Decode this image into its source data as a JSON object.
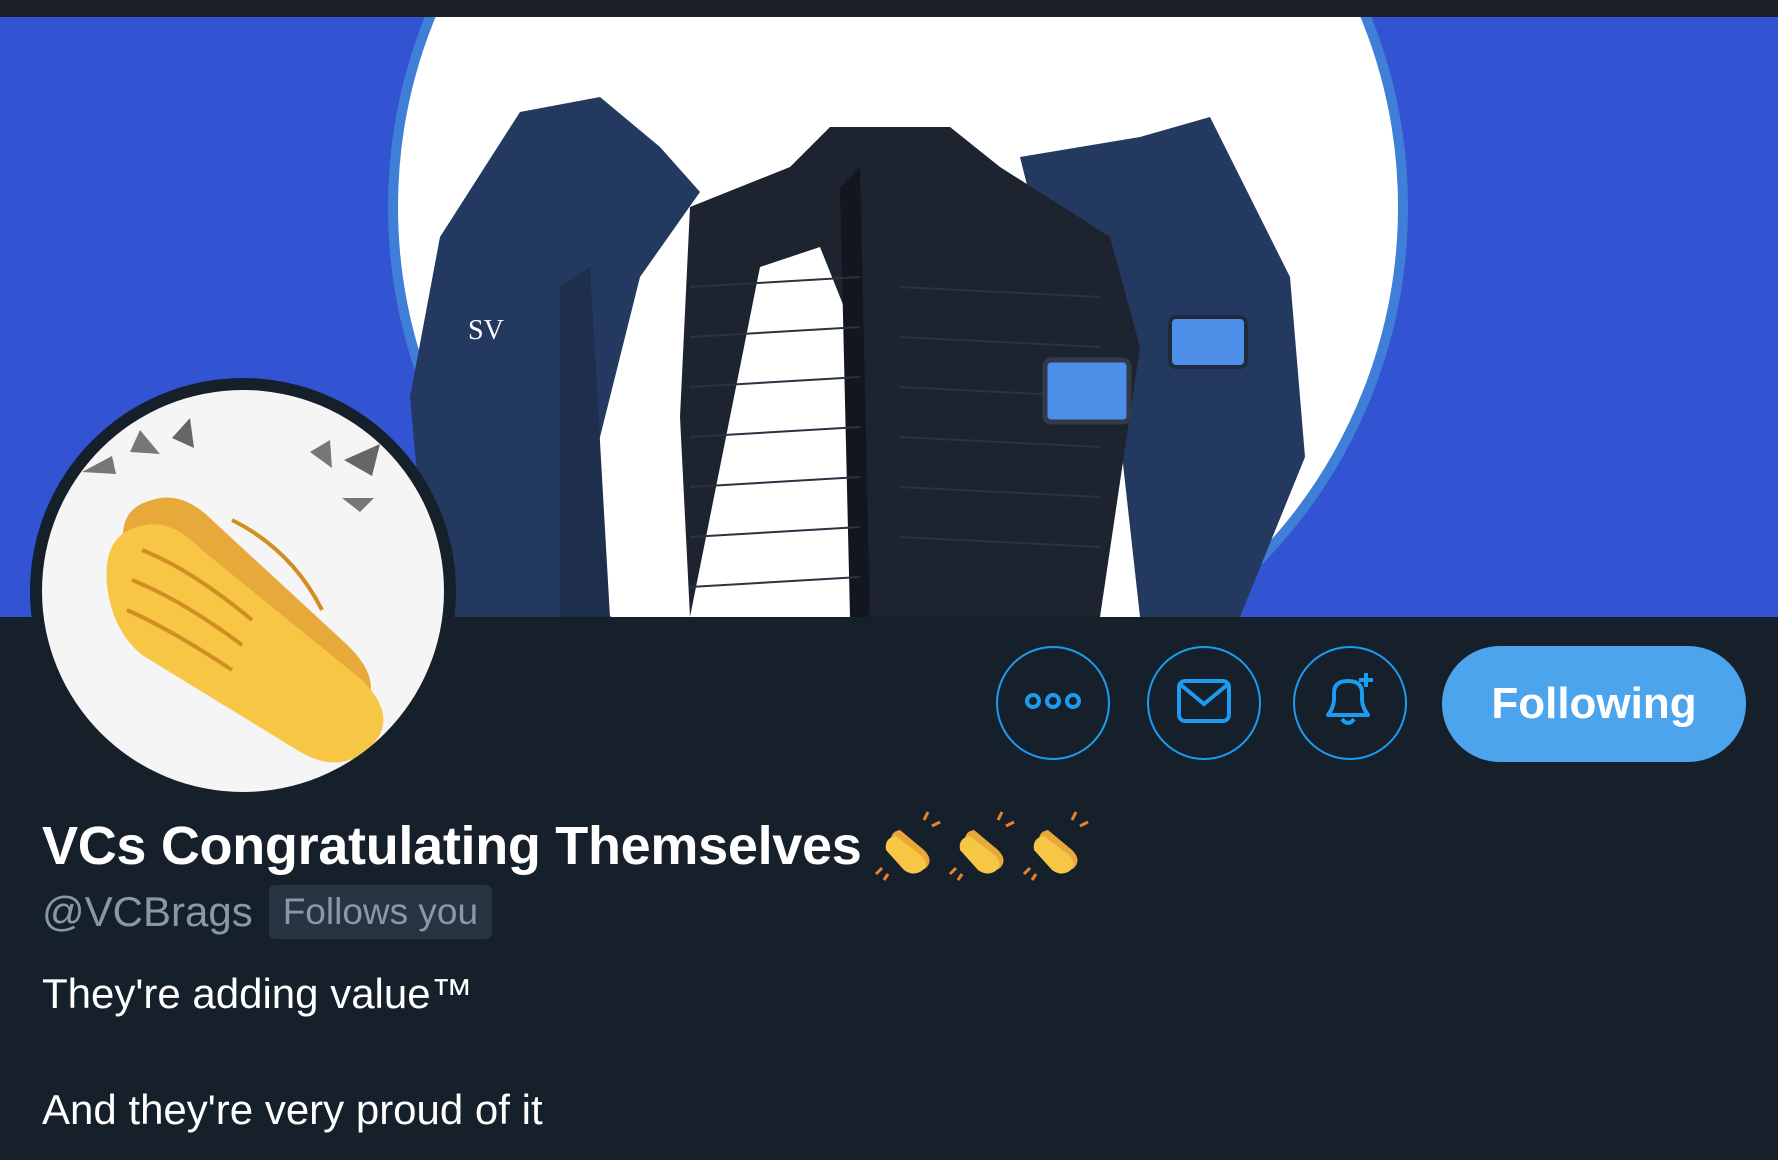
{
  "profile": {
    "display_name": "VCs Congratulating Themselves",
    "name_emojis": [
      "clap-emoji",
      "clap-emoji",
      "clap-emoji"
    ],
    "handle": "@VCBrags",
    "follows_you_label": "Follows you",
    "bio_lines": [
      "They're adding value™",
      "And they're very proud of it"
    ]
  },
  "actions": {
    "more_icon": "more-horizontal-icon",
    "message_icon": "envelope-icon",
    "notify_icon": "bell-plus-icon",
    "follow_label": "Following"
  },
  "colors": {
    "banner_blue": "#3254d2",
    "page_background": "#15202b",
    "accent_blue": "#1d9bf0",
    "following_button": "#4ba4ec",
    "muted_text": "#8899a6"
  }
}
